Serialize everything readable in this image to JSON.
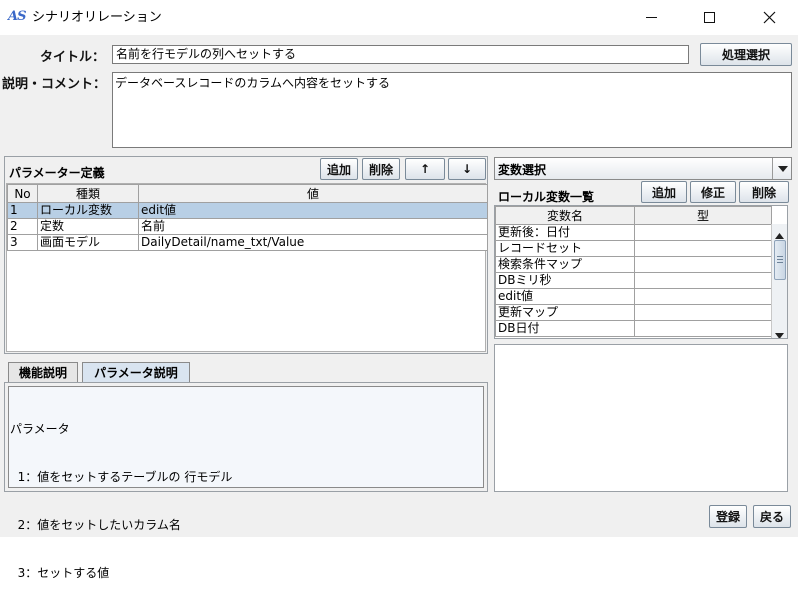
{
  "window": {
    "title": "シナリオリレーション",
    "app_icon_text": "AS"
  },
  "form": {
    "title_label": "タイトル：",
    "title_value": "名前を行モデルの列へセットする",
    "process_select_button": "処理選択",
    "comment_label": "説明・コメント：",
    "comment_value": "データベースレコードのカラムへ内容をセットする"
  },
  "params": {
    "title": "パラメーター定義",
    "add_button": "追加",
    "delete_button": "削除",
    "up_button": "↑",
    "down_button": "↓",
    "columns": [
      "No",
      "種類",
      "値"
    ],
    "rows": [
      [
        "1",
        "ローカル変数",
        "edit値"
      ],
      [
        "2",
        "定数",
        "名前"
      ],
      [
        "3",
        "画面モデル",
        "DailyDetail/name_txt/Value"
      ]
    ]
  },
  "tabs": {
    "items": [
      "機能説明",
      "パラメータ説明"
    ],
    "active": 1,
    "content_lines": [
      "パラメータ",
      "  1：値をセットするテーブルの 行モデル",
      "  2：値をセットしたいカラム名",
      "  3：セットする値"
    ]
  },
  "variables": {
    "select_value": "変数選択",
    "list_title": "ローカル変数一覧",
    "add_button": "追加",
    "edit_button": "修正",
    "delete_button": "削除",
    "columns": [
      "変数名",
      "型"
    ],
    "rows": [
      [
        "更新後：日付",
        ""
      ],
      [
        "レコードセット",
        ""
      ],
      [
        "検索条件マップ",
        ""
      ],
      [
        "DBミリ秒",
        ""
      ],
      [
        "edit値",
        ""
      ],
      [
        "更新マップ",
        ""
      ],
      [
        "DB日付",
        ""
      ]
    ]
  },
  "footer": {
    "register_button": "登録",
    "back_button": "戻る"
  }
}
